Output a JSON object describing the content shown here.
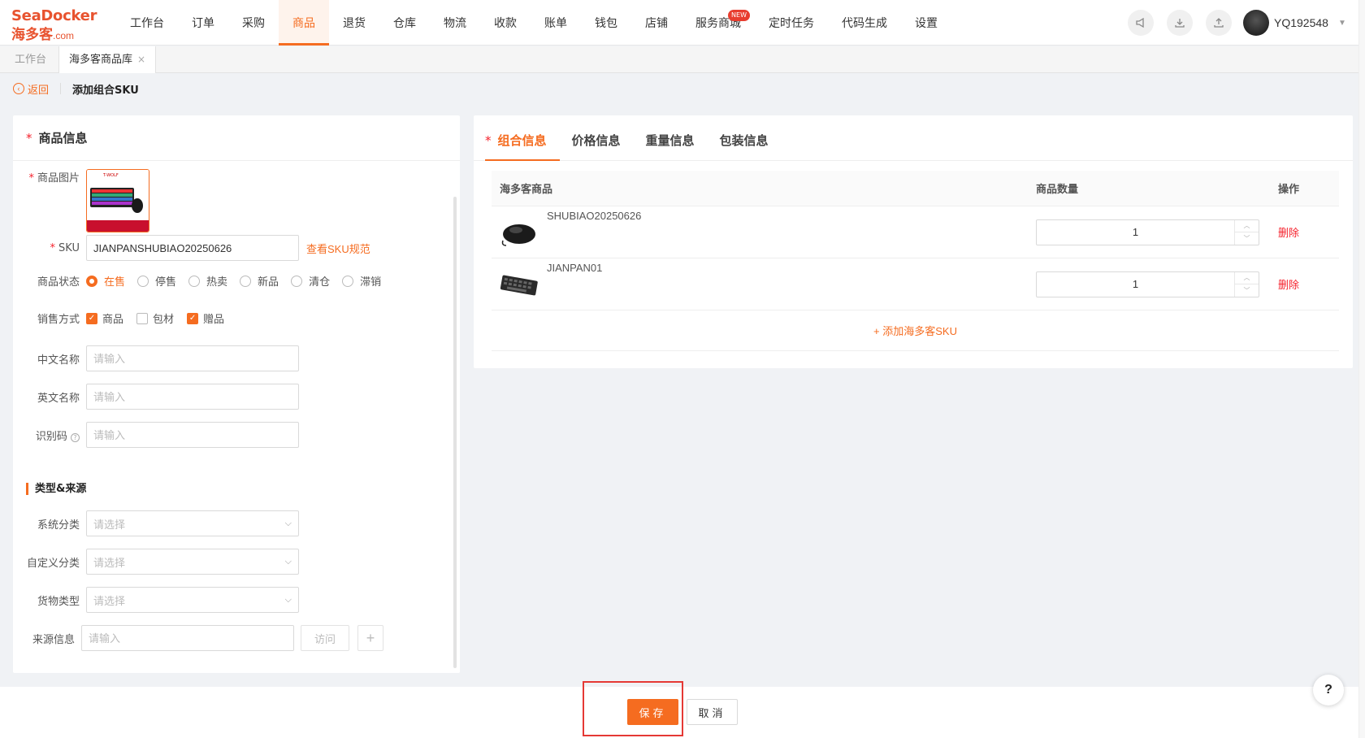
{
  "app": {
    "logo_line1": "SeaDocker",
    "logo_line2": "海多客",
    "logo_domain": ".com"
  },
  "nav": {
    "items": [
      {
        "label": "工作台"
      },
      {
        "label": "订单"
      },
      {
        "label": "采购"
      },
      {
        "label": "商品"
      },
      {
        "label": "退货"
      },
      {
        "label": "仓库"
      },
      {
        "label": "物流"
      },
      {
        "label": "收款"
      },
      {
        "label": "账单"
      },
      {
        "label": "钱包"
      },
      {
        "label": "店铺"
      },
      {
        "label": "服务商城"
      },
      {
        "label": "定时任务"
      },
      {
        "label": "代码生成"
      },
      {
        "label": "设置"
      }
    ],
    "active_index": 3,
    "badge_text": "NEW"
  },
  "user": {
    "name": "YQ192548"
  },
  "tabs": {
    "workbench": "工作台",
    "library": "海多客商品库",
    "close": "×"
  },
  "breadcrumb": {
    "back": "返回",
    "title": "添加组合SKU"
  },
  "left_panel": {
    "title": "商品信息",
    "image_label": "商品图片",
    "sku_label": "SKU",
    "sku_value": "JIANPANSHUBIAO20250626",
    "sku_link": "查看SKU规范",
    "status_label": "商品状态",
    "status_options": [
      "在售",
      "停售",
      "热卖",
      "新品",
      "清仓",
      "滞销"
    ],
    "status_selected": 0,
    "sale_label": "销售方式",
    "sale_options": [
      {
        "label": "商品",
        "checked": true
      },
      {
        "label": "包材",
        "checked": false
      },
      {
        "label": "赠品",
        "checked": true
      }
    ],
    "cn_name_label": "中文名称",
    "en_name_label": "英文名称",
    "id_code_label": "识别码",
    "input_placeholder": "请输入",
    "section_title": "类型&来源",
    "sys_cat_label": "系统分类",
    "custom_cat_label": "自定义分类",
    "cargo_type_label": "货物类型",
    "select_placeholder": "请选择",
    "source_label": "来源信息",
    "visit_button": "访问",
    "add_button": "+"
  },
  "right_panel": {
    "tabs": [
      "组合信息",
      "价格信息",
      "重量信息",
      "包装信息"
    ],
    "columns": [
      "海多客商品",
      "商品数量",
      "操作"
    ],
    "rows": [
      {
        "sku": "SHUBIAO20250626",
        "qty": "1",
        "action": "删除"
      },
      {
        "sku": "JIANPAN01",
        "qty": "1",
        "action": "删除"
      }
    ],
    "add_link": "+ 添加海多客SKU"
  },
  "footer": {
    "save": "保存",
    "cancel": "取消"
  },
  "help": "?",
  "colors": {
    "accent": "#f56c20",
    "danger": "#f5222d",
    "highlight": "#e53935"
  }
}
